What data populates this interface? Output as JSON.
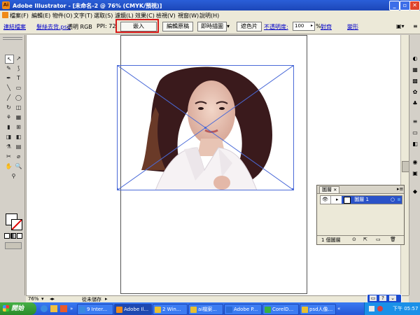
{
  "window": {
    "title": "Adobe Illustrator - [未命名-2 @ 76% (CMYK/預視)]",
    "app_icon_glyph": "Ai",
    "min_glyph": "_",
    "restore_glyph": "▫",
    "close_glyph": "✕"
  },
  "menu": [
    "檔案(F)",
    "編輯(E)",
    "物件(O)",
    "文字(T)",
    "選取(S)",
    "濾鏡(L)",
    "效果(C)",
    "檢視(V)",
    "視窗(W)",
    "說明(H)"
  ],
  "control_bar": {
    "linked_file": "連結檔案",
    "file_name": "髮絲去背.psd",
    "mode": "透明 RGB",
    "ppi": "PPI: 72",
    "embed_button": "嵌入",
    "edit_original_button": "編輯原稿",
    "live_trace_button": "即時描圖",
    "mask_button": "遮色片",
    "opacity_label": "不透明度:",
    "opacity_value": "100",
    "percent": "%",
    "align_link": "對齊",
    "transform_link": "變形"
  },
  "tools": [
    "↖",
    "↗",
    "✎",
    "⟆",
    "✒",
    "T",
    "╲",
    "▭",
    "╱",
    "◯",
    "↻",
    "◫",
    "⚘",
    "▦",
    "▮",
    "⊞",
    "◨",
    "◧",
    "⚗",
    "▤",
    "✂",
    "⌀",
    "✋",
    "🔍",
    "⚲"
  ],
  "status": {
    "zoom": "76%",
    "save_status": "從未儲存"
  },
  "layers_panel": {
    "tab_label": "圖層",
    "layer_name": "圖層 1",
    "footer_count": "1 個圖層",
    "close_glyph": "✕"
  },
  "taskbar": {
    "start_label": "開始",
    "items": [
      {
        "label": "9 Inter...",
        "color": "#3a8ae0"
      },
      {
        "label": "Adobe Il...",
        "color": "#f08a18"
      },
      {
        "label": "2 Win...",
        "color": "#e8c030"
      },
      {
        "label": "ai檔案...",
        "color": "#e8c030"
      },
      {
        "label": "Adobe P...",
        "color": "#2a6ad8"
      },
      {
        "label": "CorelD...",
        "color": "#3ab040"
      },
      {
        "label": "psd人像...",
        "color": "#e8c030"
      }
    ],
    "clock": "下午 05:57"
  },
  "lang_bar": [
    "▭",
    "?",
    "⌄"
  ],
  "colors": {
    "titlebar": "#1c46b8",
    "highlight_box": "#d81818",
    "selection_blue": "#2a52c8"
  }
}
